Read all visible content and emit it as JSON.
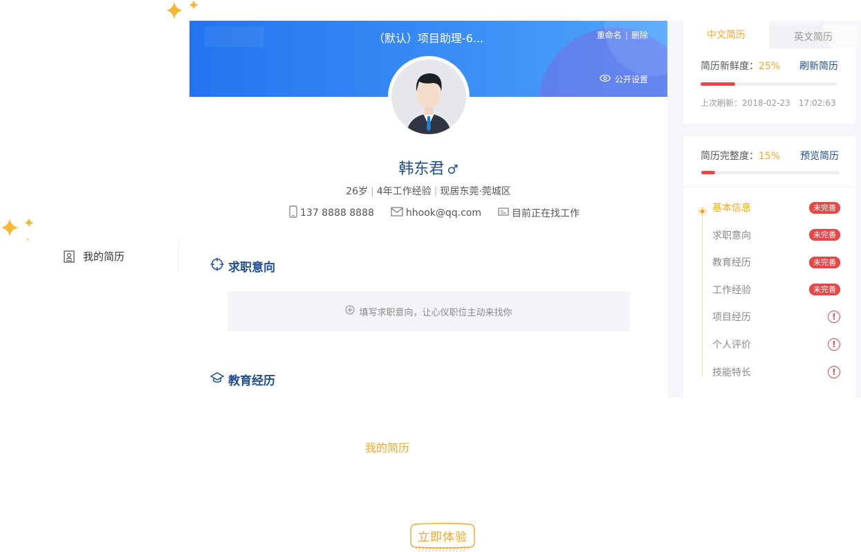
{
  "sidebar": {
    "items": [
      {
        "label": "我的简历",
        "icon": "resume-icon"
      }
    ]
  },
  "resume": {
    "banner_title": "（默认）项目助理-6...",
    "rename_label": "重命名",
    "separator": "|",
    "delete_label": "删除",
    "public_label": "公开设置",
    "name": "韩东君",
    "gender_symbol": "♂",
    "age": "26岁",
    "experience": "4年工作经验",
    "location": "现居东莞·莞城区",
    "phone": "137 8888 8888",
    "email": "hhook@qq.com",
    "job_status": "目前正在找工作",
    "sections": {
      "intention_title": "求职意向",
      "intention_fill_text": "填写求职意向，让心仪职位主动来找你",
      "education_title": "教育经历"
    }
  },
  "right_panel": {
    "tabs": [
      {
        "label": "中文简历",
        "active": true
      },
      {
        "label": "英文简历",
        "active": false
      }
    ],
    "freshness": {
      "label": "简历新鲜度：",
      "value": "25%",
      "progress": 0.25,
      "action_label": "刷新简历",
      "last_refresh": "上次刷新：2018-02-23　17:02:63"
    },
    "completeness": {
      "label": "简历完整度：",
      "value": "15%",
      "progress": 0.1,
      "action_label": "预览简历"
    },
    "checklist": [
      {
        "label": "基本信息",
        "status": "未完善",
        "type": "badge",
        "active": true
      },
      {
        "label": "求职意向",
        "status": "未完善",
        "type": "badge",
        "active": false
      },
      {
        "label": "教育经历",
        "status": "未完善",
        "type": "badge",
        "active": false
      },
      {
        "label": "工作经验",
        "status": "未完善",
        "type": "badge",
        "active": false
      },
      {
        "label": "项目经历",
        "status": "!",
        "type": "warning",
        "active": false
      },
      {
        "label": "个人评价",
        "status": "!",
        "type": "warning",
        "active": false
      },
      {
        "label": "技能特长",
        "status": "!",
        "type": "warning",
        "active": false
      }
    ]
  },
  "footer": {
    "feature_label": "我的简历",
    "cta_label": "立即体验"
  },
  "colors": {
    "accent_orange": "#f6a623",
    "brand_blue": "#2374ef",
    "title_navy": "#1e4d92",
    "alert_red": "#e54848"
  }
}
